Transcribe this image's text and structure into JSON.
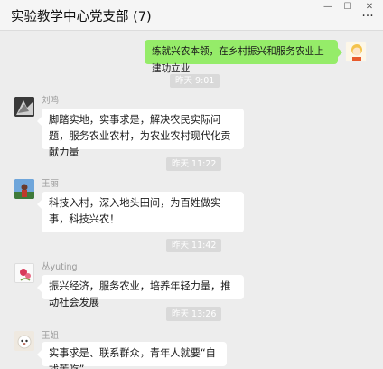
{
  "window": {
    "title": "实验教学中心党支部 (7)",
    "controls": {
      "minimize": "—",
      "maximize": "☐",
      "close": "✕"
    },
    "more_icon": "···"
  },
  "messages": [
    {
      "sender": "",
      "text": "练就兴农本领，在乡村振兴和服务农业上建功立业",
      "mine": true
    },
    {
      "timestamp": "昨天 9:01"
    },
    {
      "sender": "刘鸣",
      "text": "脚踏实地，实事求是，解决农民实际问题，服务农业农村，为农业农村现代化贡献力量"
    },
    {
      "timestamp": "昨天 11:22"
    },
    {
      "sender": "王丽",
      "text": "科技入村，深入地头田间，为百姓做实事，科技兴农！"
    },
    {
      "timestamp": "昨天 11:42"
    },
    {
      "sender": "丛yuting",
      "text": "振兴经济，服务农业，培养年轻力量，推动社会发展"
    },
    {
      "timestamp": "昨天 13:26"
    },
    {
      "sender": "王姐",
      "text": "实事求是、联系群众，青年人就要“自找苦吃”"
    }
  ],
  "colors": {
    "mine_bubble": "#95ec69",
    "other_bubble": "#ffffff",
    "chat_bg": "#ededed"
  }
}
